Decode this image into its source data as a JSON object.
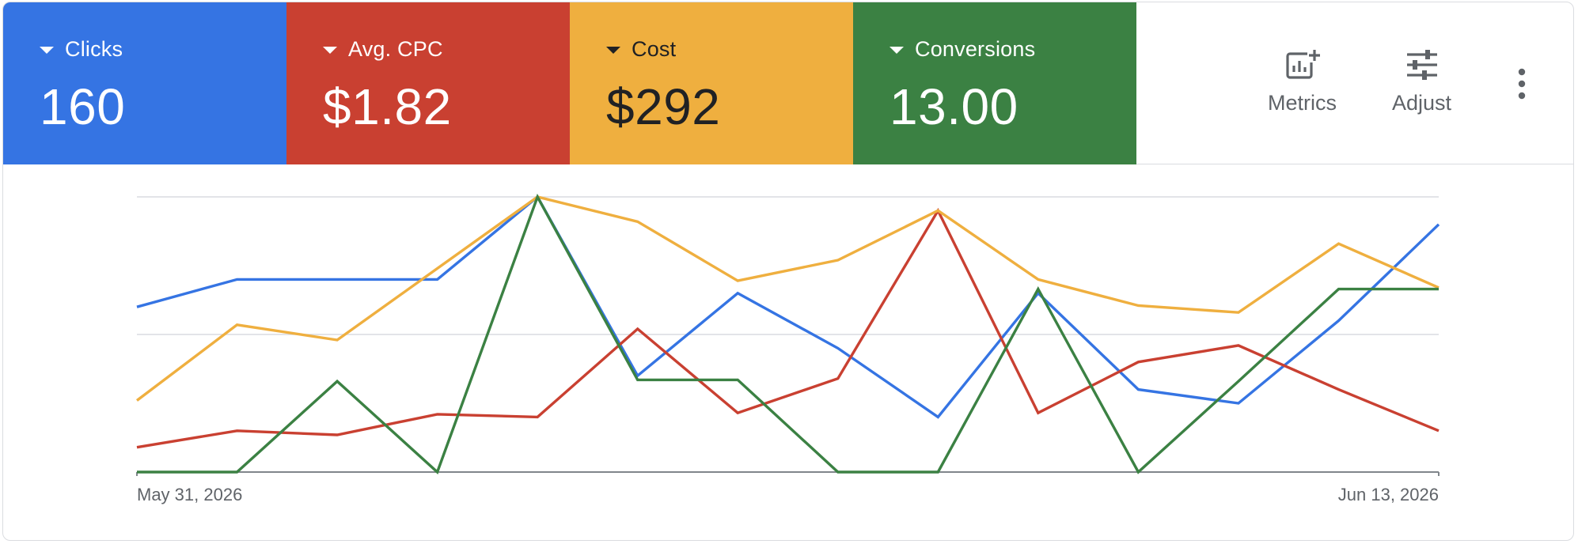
{
  "metrics": [
    {
      "key": "clicks",
      "label": "Clicks",
      "value": "160",
      "color": "#3574e3",
      "dark_text": false
    },
    {
      "key": "avg_cpc",
      "label": "Avg. CPC",
      "value": "$1.82",
      "color": "#c94031",
      "dark_text": false
    },
    {
      "key": "cost",
      "label": "Cost",
      "value": "$292",
      "color": "#efaf3f",
      "dark_text": true
    },
    {
      "key": "conversions",
      "label": "Conversions",
      "value": "13.00",
      "color": "#3b8143",
      "dark_text": false
    }
  ],
  "toolbar": {
    "metrics_label": "Metrics",
    "adjust_label": "Adjust",
    "metrics_icon": "add-chart-icon",
    "adjust_icon": "tune-icon",
    "more_icon": "more-vert-icon"
  },
  "chart_data": {
    "type": "line",
    "x": [
      "May 31, 2026",
      "Jun 1, 2026",
      "Jun 2, 2026",
      "Jun 3, 2026",
      "Jun 4, 2026",
      "Jun 5, 2026",
      "Jun 6, 2026",
      "Jun 7, 2026",
      "Jun 8, 2026",
      "Jun 9, 2026",
      "Jun 10, 2026",
      "Jun 11, 2026",
      "Jun 12, 2026",
      "Jun 13, 2026"
    ],
    "x_tick_labels": [
      "May 31, 2026",
      "Jun 13, 2026"
    ],
    "grid": true,
    "normalized_scale": [
      0,
      1
    ],
    "series": [
      {
        "color": "#3574e3",
        "values": [
          0.6,
          0.7,
          0.7,
          0.7,
          1.0,
          0.35,
          0.65,
          0.45,
          0.2,
          0.65,
          0.3,
          0.25,
          0.55,
          0.9
        ]
      },
      {
        "color": "#c94031",
        "values": [
          0.09,
          0.15,
          0.135,
          0.21,
          0.2,
          0.52,
          0.215,
          0.34,
          0.95,
          0.215,
          0.4,
          0.46,
          0.3,
          0.15
        ]
      },
      {
        "color": "#efaf3f",
        "values": [
          0.26,
          0.535,
          0.48,
          0.74,
          1.0,
          0.91,
          0.695,
          0.77,
          0.95,
          0.7,
          0.605,
          0.58,
          0.83,
          0.67
        ]
      },
      {
        "color": "#3b8143",
        "values": [
          0.0,
          0.0,
          0.33,
          0.0,
          1.0,
          0.335,
          0.335,
          0.0,
          0.0,
          0.665,
          0.0,
          0.33,
          0.665,
          0.665
        ]
      }
    ]
  }
}
